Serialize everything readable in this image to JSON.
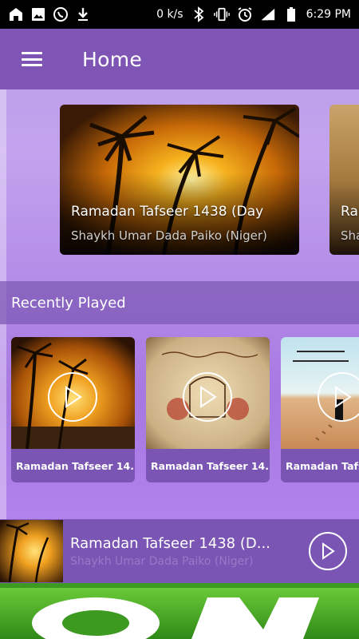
{
  "status_bar": {
    "net_speed": "0 k/s",
    "time": "6:29 PM",
    "icons": [
      "home-icon",
      "image-icon",
      "whatsapp-icon",
      "download-icon",
      "bluetooth-icon",
      "vibrate-icon",
      "alarm-icon",
      "signal-icon",
      "battery-icon"
    ]
  },
  "app_bar": {
    "menu_icon": "hamburger-menu-icon",
    "title": "Home"
  },
  "featured": [
    {
      "title": "Ramadan Tafseer 1438 (Day",
      "subtitle": "Shaykh Umar Dada Paiko (Niger)",
      "image": "palm-sunset"
    },
    {
      "title": "Ran",
      "subtitle": "Sha",
      "image": "parchment"
    }
  ],
  "recently_played": {
    "header": "Recently Played",
    "items": [
      {
        "label": "Ramadan Tafseer 14...",
        "image": "palm-sunset"
      },
      {
        "label": "Ramadan Tafseer 14...",
        "image": "calligraphy-parchment"
      },
      {
        "label": "Ramadan Tafs",
        "image": "desert-footprints"
      }
    ]
  },
  "player": {
    "title": "Ramadan Tafseer 1438 (D...",
    "subtitle": "Shaykh Umar Dada Paiko (Niger)",
    "play_icon": "play-icon"
  },
  "colors": {
    "primary": "#7e55b4",
    "accent_bg": "#b79be6",
    "ad_green": "#4caa2a"
  }
}
